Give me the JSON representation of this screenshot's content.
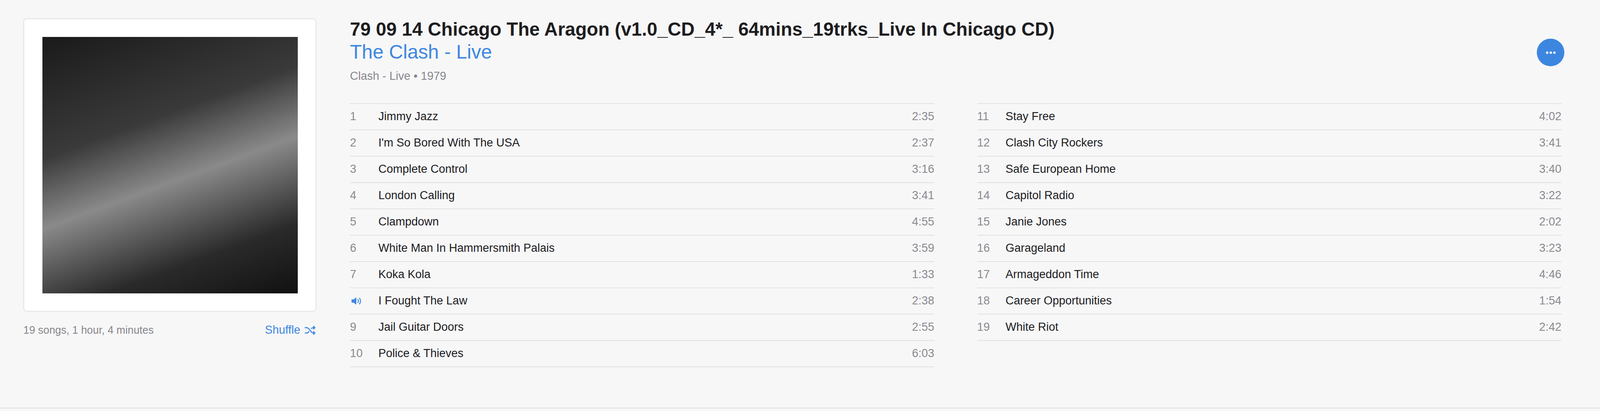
{
  "album": {
    "title": "79 09 14 Chicago The Aragon (v1.0_CD_4*_ 64mins_19trks_Live In Chicago CD)",
    "artist": "The Clash - Live",
    "meta": "Clash - Live • 1979",
    "summary": "19 songs, 1 hour, 4 minutes",
    "shuffle": "Shuffle"
  },
  "columns": [
    [
      {
        "number": "1",
        "title": "Jimmy Jazz",
        "duration": "2:35",
        "playing": false
      },
      {
        "number": "2",
        "title": "I'm So Bored With The USA",
        "duration": "2:37",
        "playing": false
      },
      {
        "number": "3",
        "title": "Complete Control",
        "duration": "3:16",
        "playing": false
      },
      {
        "number": "4",
        "title": "London Calling",
        "duration": "3:41",
        "playing": false
      },
      {
        "number": "5",
        "title": "Clampdown",
        "duration": "4:55",
        "playing": false
      },
      {
        "number": "6",
        "title": "White Man In Hammersmith Palais",
        "duration": "3:59",
        "playing": false
      },
      {
        "number": "7",
        "title": "Koka Kola",
        "duration": "1:33",
        "playing": false
      },
      {
        "number": "",
        "title": "I Fought The Law",
        "duration": "2:38",
        "playing": true
      },
      {
        "number": "9",
        "title": "Jail Guitar Doors",
        "duration": "2:55",
        "playing": false
      },
      {
        "number": "10",
        "title": "Police & Thieves",
        "duration": "6:03",
        "playing": false
      }
    ],
    [
      {
        "number": "11",
        "title": "Stay Free",
        "duration": "4:02",
        "playing": false
      },
      {
        "number": "12",
        "title": "Clash City Rockers",
        "duration": "3:41",
        "playing": false
      },
      {
        "number": "13",
        "title": "Safe European Home",
        "duration": "3:40",
        "playing": false
      },
      {
        "number": "14",
        "title": "Capitol Radio",
        "duration": "3:22",
        "playing": false
      },
      {
        "number": "15",
        "title": "Janie Jones",
        "duration": "2:02",
        "playing": false
      },
      {
        "number": "16",
        "title": "Garageland",
        "duration": "3:23",
        "playing": false
      },
      {
        "number": "17",
        "title": "Armageddon Time",
        "duration": "4:46",
        "playing": false
      },
      {
        "number": "18",
        "title": "Career Opportunities",
        "duration": "1:54",
        "playing": false
      },
      {
        "number": "19",
        "title": "White Riot",
        "duration": "2:42",
        "playing": false
      }
    ]
  ]
}
